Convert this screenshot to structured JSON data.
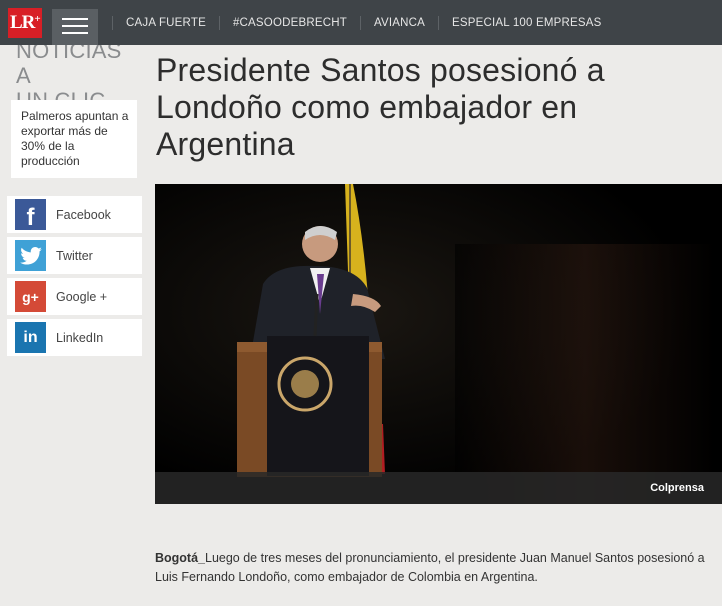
{
  "header": {
    "logo_text": "LR",
    "logo_plus": "+",
    "brand_color": "#d81f26",
    "nav": [
      "CAJA FUERTE",
      "#CASOODEBRECHT",
      "AVIANCA",
      "ESPECIAL 100 EMPRESAS"
    ]
  },
  "sidebar": {
    "section_title_line1": "NOTICIAS A",
    "section_title_line2": "UN CLIC",
    "teaser": "Palmeros apuntan a exportar más de 30% de la producción",
    "social": [
      {
        "icon": "facebook-icon",
        "label": "Facebook",
        "color": "#3b5998"
      },
      {
        "icon": "twitter-icon",
        "label": "Twitter",
        "color": "#3fa1d6"
      },
      {
        "icon": "googleplus-icon",
        "label": "Google +",
        "color": "#d44a37"
      },
      {
        "icon": "linkedin-icon",
        "label": "LinkedIn",
        "color": "#1a75b0"
      }
    ]
  },
  "article": {
    "headline": "Presidente Santos posesionó a Londoño como embajador en Argentina",
    "photo_credit": "Colprensa",
    "dateline": "Bogotá_",
    "lede": "Luego de tres meses del pronunciamiento, el presidente Juan Manuel Santos posesionó a Luis Fernando Londoño, como embajador de Colombia en Argentina."
  }
}
